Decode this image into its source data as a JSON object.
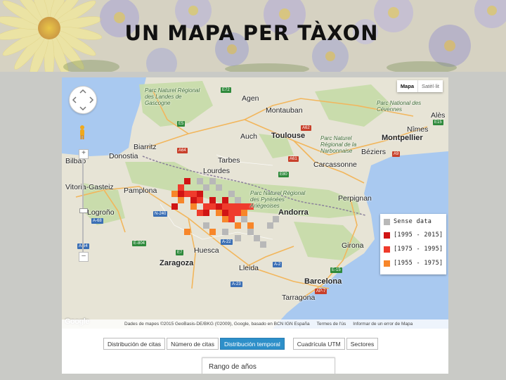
{
  "slide": {
    "title": "UN MAPA PER TÀXON"
  },
  "map": {
    "type_buttons": [
      "Mapa",
      "Satèl·lit"
    ],
    "active_type": "Mapa",
    "zoom_in": "+",
    "zoom_out": "–",
    "labels": {
      "agen": "Agen",
      "montauban": "Montauban",
      "toulouse": "Toulouse",
      "montpellier": "Montpellier",
      "nimes": "Nîmes",
      "beziers": "Béziers",
      "carcassonne": "Carcassonne",
      "perpignan": "Perpignan",
      "andorra": "Andorra",
      "girona": "Girona",
      "barcelona": "Barcelona",
      "tarragona": "Tarragona",
      "lleida": "Lleida",
      "huesca": "Huesca",
      "zaragoza": "Zaragoza",
      "pamplona": "Pamplona",
      "vitoria": "Vitoria-Gasteiz",
      "logrono": "Logroño",
      "donostia": "Donostia",
      "bilbao": "Bilbao",
      "biarritz": "Biarritz",
      "lourdes": "Lourdes",
      "tarbes": "Tarbes",
      "auch": "Auch",
      "alès": "Alès",
      "park_landes": "Parc Naturel Régional des Landes de Gascogne",
      "park_cevennes": "Parc National des Cévennes",
      "park_narbonnaise": "Parc Naturel Régional de la Narbonnaise",
      "park_pyrenees": "Parc Naturel Régional des Pyrénées Ariégeoises"
    },
    "road_badges": [
      "E72",
      "A62",
      "A61",
      "E80",
      "A9",
      "E15",
      "A64",
      "E5",
      "E7",
      "N-240",
      "A-22",
      "E-15",
      "A-2",
      "AP-7",
      "A-23",
      "E-804",
      "A-68",
      "A-64"
    ],
    "legend": [
      {
        "label": "Sense data",
        "color": "#b8b8b8"
      },
      {
        "label": "[1995 - 2015]",
        "color": "#d01414"
      },
      {
        "label": "[1975 - 1995]",
        "color": "#ef3b2c"
      },
      {
        "label": "[1955 - 1975]",
        "color": "#f7862a"
      }
    ],
    "attribution": [
      "Dades de mapes ©2015 GeoBasis-DE/BKG (©2009), Google, basado en BCN IGN España",
      "Termes de l'ús",
      "Informar de un error de Mapa"
    ],
    "google_logo": "Google"
  },
  "toolbar": {
    "buttons": [
      "Distribución de citas",
      "Número de citas",
      "Distribución temporal",
      "Cuadrícula UTM",
      "Sectores"
    ],
    "active_index": 2
  },
  "range_panel": {
    "label": "Rango de años"
  }
}
